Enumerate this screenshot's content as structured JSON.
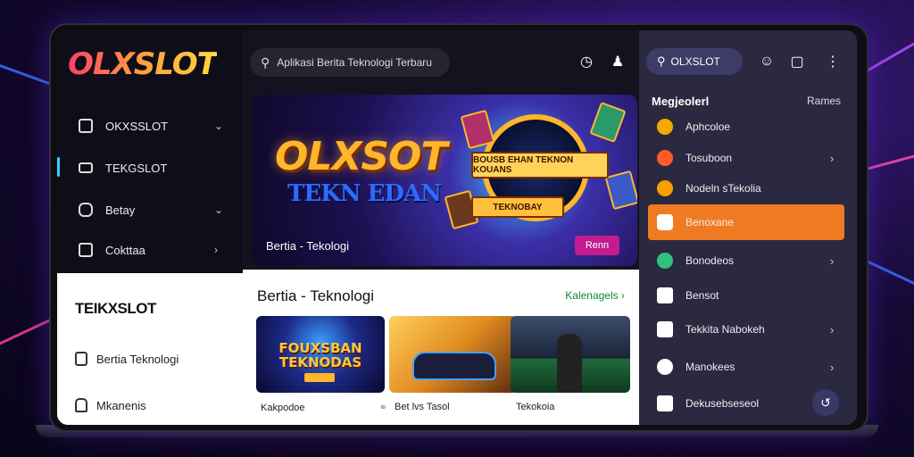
{
  "brand": {
    "logo": "OLXSLOT"
  },
  "search": {
    "placeholder": "Aplikasi Berita Teknologi Terbaru"
  },
  "nav": {
    "items": [
      {
        "label": "OKXSSLOT",
        "icon": "door-icon"
      },
      {
        "label": "TEKGSLOT",
        "icon": "monitor-icon"
      },
      {
        "label": "Betay",
        "icon": "gamepad-icon"
      },
      {
        "label": "Cokttaa",
        "icon": "bag-icon"
      }
    ]
  },
  "lower_left": {
    "title": "TEIKXSLOT",
    "items": [
      {
        "label": "Bertia Teknologi",
        "icon": "phone-icon"
      },
      {
        "label": "Mkanenis",
        "icon": "shirt-icon"
      }
    ]
  },
  "banner": {
    "title": "OLXSOT",
    "subtitle": "TEKN EDAN",
    "wheel_label": "BOUSB EHAN TEKNON KOUANS",
    "wheel_label2": "TEKNOBAY",
    "caption": "Bertia - Tekologi",
    "button": "Renn"
  },
  "news": {
    "title": "Bertia - Teknologi",
    "more": "Kalenagels",
    "items": [
      {
        "caption": "Kakpodoe",
        "overlay": "FOUXSBAN TEKNODAS"
      },
      {
        "caption": "Bet lvs Tasol"
      },
      {
        "caption": "Tekokoia"
      }
    ]
  },
  "right_panel": {
    "search": "OLXSLOT",
    "heading": "Megjeolerl",
    "heading_right": "Rames",
    "items": [
      {
        "label": "Aphcoloe",
        "color": "#f2a900"
      },
      {
        "label": "Tosuboon",
        "color": "#ff5a2a"
      },
      {
        "label": "Nodeln sTekolia",
        "color": "#f7a000"
      },
      {
        "label": "Benoxane",
        "color": "#ffffff"
      },
      {
        "label": "Bonodeos",
        "color": "#2ec27e"
      },
      {
        "label": "Bensot",
        "color": "#ffffff"
      },
      {
        "label": "Tekkita Nabokeh",
        "color": "#ffffff"
      },
      {
        "label": "Manokees",
        "color": "#ffffff"
      },
      {
        "label": "Dekusebseseol",
        "color": "#ffffff"
      }
    ]
  },
  "colors": {
    "accent": "#f07a22",
    "background": "#150a35"
  }
}
